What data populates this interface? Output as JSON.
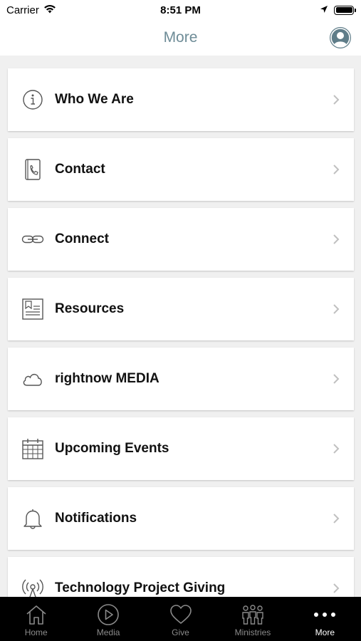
{
  "status_bar": {
    "carrier": "Carrier",
    "time": "8:51 PM"
  },
  "header": {
    "title": "More"
  },
  "menu": {
    "items": [
      {
        "label": "Who We Are",
        "icon": "info-icon"
      },
      {
        "label": "Contact",
        "icon": "phone-book-icon"
      },
      {
        "label": "Connect",
        "icon": "link-icon"
      },
      {
        "label": "Resources",
        "icon": "document-icon"
      },
      {
        "label": "rightnow MEDIA",
        "icon": "cloud-icon"
      },
      {
        "label": "Upcoming Events",
        "icon": "calendar-icon"
      },
      {
        "label": "Notifications",
        "icon": "bell-icon"
      },
      {
        "label": "Technology Project Giving",
        "icon": "broadcast-tower-icon"
      }
    ]
  },
  "tab_bar": {
    "tabs": [
      {
        "label": "Home",
        "icon": "home-icon"
      },
      {
        "label": "Media",
        "icon": "play-icon"
      },
      {
        "label": "Give",
        "icon": "heart-icon"
      },
      {
        "label": "Ministries",
        "icon": "people-icon"
      },
      {
        "label": "More",
        "icon": "more-dots-icon",
        "active": true
      }
    ]
  },
  "colors": {
    "header_title": "#6e8c97",
    "profile_icon": "#5f7d89",
    "background": "#f0f0f0",
    "tab_bar": "#000000"
  }
}
